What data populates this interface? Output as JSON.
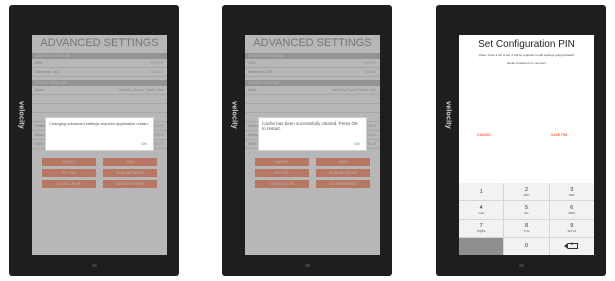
{
  "brand": "velocity",
  "advanced_screen": {
    "title": "ADVANCED SETTINGS",
    "gateway_section": "Gateway Settings",
    "gateway_rows": [
      {
        "label": "URL",
        "value": "0.0.0.0"
      },
      {
        "label": "Alternate URL",
        "value": "0.0.0.0"
      }
    ],
    "device_section": "Device Settings",
    "device_rows": [
      {
        "label": "Alias",
        "value": "Velocity Touch Panel 4tst"
      },
      {
        "label": "",
        "value": ""
      },
      {
        "label": "",
        "value": ""
      },
      {
        "label": "",
        "value": ""
      },
      {
        "label": "Subnet Mask",
        "value": "255.255.255.0"
      },
      {
        "label": "Default Gateway",
        "value": "0.0.0.0"
      },
      {
        "label": "DNS Server",
        "value": "75.75.75.75"
      }
    ],
    "buttons": [
      [
        "CANCEL",
        "SAVE"
      ],
      [
        "SET PIN",
        "SCAN NETWORK"
      ],
      [
        "CLEAR CACHE",
        "FACTORY RESET"
      ]
    ]
  },
  "dialog_1": {
    "message": "Changing advanced settings requires application restart.",
    "ok": "OK"
  },
  "dialog_2": {
    "message": "Cache has been successfully cleared. Press OK to restart.",
    "ok": "OK"
  },
  "pin_screen": {
    "title": "Set Configuration PIN",
    "note": "(Note: Once a pin is set, it will be required to edit settings going forward)",
    "subnote": "(Enter a blank pin to remove)",
    "cancel": "CANCEL",
    "save": "SAVE PIN"
  },
  "keypad": [
    {
      "digit": "1",
      "letters": ""
    },
    {
      "digit": "2",
      "letters": "ABC"
    },
    {
      "digit": "3",
      "letters": "DEF"
    },
    {
      "digit": "4",
      "letters": "GHI"
    },
    {
      "digit": "5",
      "letters": "JKL"
    },
    {
      "digit": "6",
      "letters": "MNO"
    },
    {
      "digit": "7",
      "letters": "PQRS"
    },
    {
      "digit": "8",
      "letters": "TUV"
    },
    {
      "digit": "9",
      "letters": "WXYZ"
    },
    {
      "digit": "0",
      "letters": ""
    }
  ],
  "colors": {
    "accent": "#ff6a3c",
    "button": "#ff8a65",
    "ok": "#2e9e4a",
    "device": "#1e1e1e"
  }
}
